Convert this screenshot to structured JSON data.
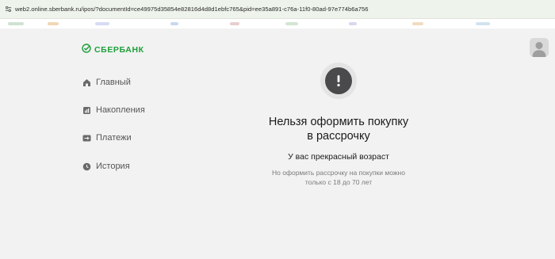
{
  "browser": {
    "url": "web2.online.sberbank.ru/ipos/?documentId=ce49975d35854e82816d4d8d1ebfc765&pid=ee35a891-c76a-11f0-80ad-97e774b6a756",
    "url_icon": "site-settings-icon"
  },
  "header": {
    "logo_text": "СБЕРБАНК",
    "logo_icon": "sber-check-icon",
    "avatar_icon": "user-avatar-icon",
    "brand_color": "#1d9f3b"
  },
  "nav": {
    "items": [
      {
        "label": "Главный",
        "icon": "home-icon"
      },
      {
        "label": "Накопления",
        "icon": "savings-chart-icon"
      },
      {
        "label": "Платежи",
        "icon": "transfer-icon"
      },
      {
        "label": "История",
        "icon": "history-icon"
      }
    ]
  },
  "message": {
    "icon": "exclamation-icon",
    "title_line1": "Нельзя оформить покупку",
    "title_line2": "в рассрочку",
    "subtitle": "У вас прекрасный возраст",
    "desc_line1": "Но оформить рассрочку на покупки можно",
    "desc_line2": "только с 18 до 70 лет"
  }
}
